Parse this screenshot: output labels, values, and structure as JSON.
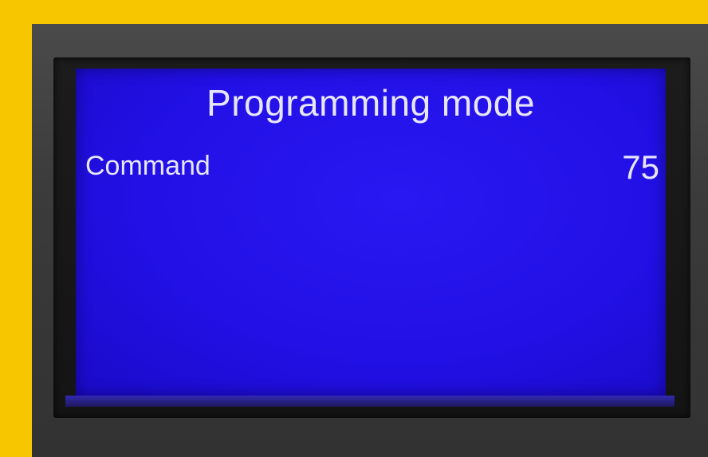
{
  "colors": {
    "background": "#f7c600",
    "bezel": "#3b3b3b",
    "lcd": "#2210e6",
    "lcd_text": "#e8e6ff"
  },
  "screen": {
    "title": "Programming mode",
    "rows": [
      {
        "label": "Command",
        "value": "75"
      }
    ]
  }
}
